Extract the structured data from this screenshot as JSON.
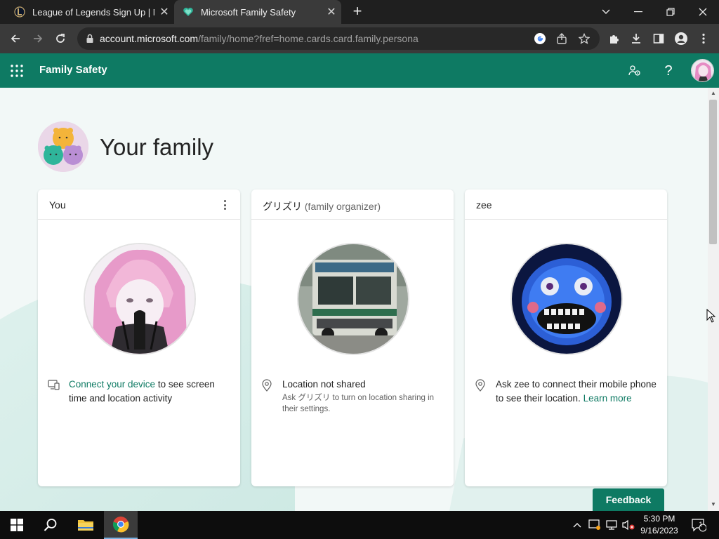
{
  "browser": {
    "tabs": [
      {
        "title": "League of Legends Sign Up | Nor",
        "icon": "league-of-legends-icon"
      },
      {
        "title": "Microsoft Family Safety",
        "icon": "heart-icon"
      }
    ],
    "url_host": "account.microsoft.com",
    "url_path": "/family/home?fref=home.cards.card.family.persona"
  },
  "app": {
    "title": "Family Safety",
    "brand_color": "#0e7a63"
  },
  "page": {
    "heading": "Your family",
    "members": [
      {
        "name": "You",
        "role": "",
        "info_link": "Connect your device",
        "info_text": " to see screen time and location activity",
        "info_icon": "device-icon"
      },
      {
        "name": "グリズリ",
        "role": "(family organizer)",
        "info_title": "Location not shared",
        "info_sub": "Ask グリズリ to turn on location sharing in their settings.",
        "info_icon": "location-pin-icon"
      },
      {
        "name": "zee",
        "role": "",
        "info_text": "Ask zee to connect their mobile phone to see their location. ",
        "info_link": "Learn more",
        "info_icon": "location-pin-icon"
      }
    ],
    "feedback_label": "Feedback"
  },
  "taskbar": {
    "time": "5:30 PM",
    "date": "9/16/2023",
    "notification_count": "1"
  }
}
